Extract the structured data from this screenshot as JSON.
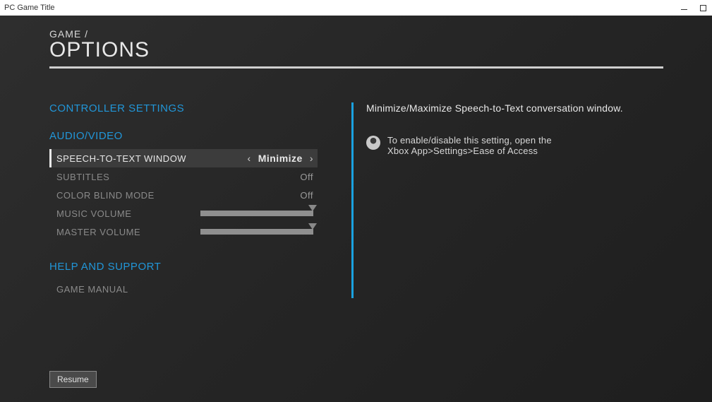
{
  "window": {
    "title": "PC Game Title"
  },
  "header": {
    "breadcrumb": "GAME  /",
    "title": "OPTIONS"
  },
  "sections": {
    "controller": {
      "title": "CONTROLLER SETTINGS"
    },
    "audiovideo": {
      "title": "AUDIO/VIDEO",
      "items": [
        {
          "label": "SPEECH-TO-TEXT WINDOW",
          "value": "Minimize",
          "type": "selector",
          "selected": true
        },
        {
          "label": "SUBTITLES",
          "value": "Off",
          "type": "toggle"
        },
        {
          "label": "COLOR BLIND MODE",
          "value": "Off",
          "type": "toggle"
        },
        {
          "label": "MUSIC VOLUME",
          "value": 100,
          "type": "slider"
        },
        {
          "label": "MASTER VOLUME",
          "value": 100,
          "type": "slider"
        }
      ]
    },
    "help": {
      "title": "HELP AND SUPPORT",
      "items": [
        {
          "label": "GAME MANUAL"
        }
      ]
    }
  },
  "detail": {
    "description": "Minimize/Maximize Speech-to-Text conversation window.",
    "hint_line1": "To enable/disable this setting, open the",
    "hint_line2": "Xbox App>Settings>Ease of Access"
  },
  "footer": {
    "resume": "Resume"
  }
}
